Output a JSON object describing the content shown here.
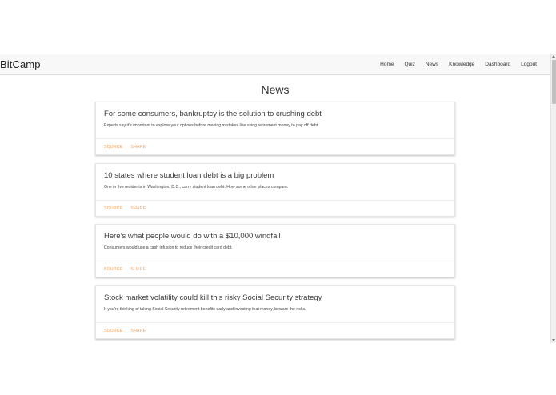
{
  "navbar": {
    "brand": "BitCamp",
    "links": [
      "Home",
      "Quiz",
      "News",
      "Knowledge",
      "Dashboard",
      "Logout"
    ]
  },
  "page": {
    "title": "News"
  },
  "articles": [
    {
      "title": "For some consumers, bankruptcy is the solution to crushing debt",
      "description": "Experts say it’s important to explore your options before making mistakes like using retirement money to pay off debt.",
      "source_label": "SOURCE",
      "share_label": "SHARE"
    },
    {
      "title": "10 states where student loan debt is a big problem",
      "description": "One in five residents in Washington, D.C., carry student loan debt. How some other places compare.",
      "source_label": "SOURCE",
      "share_label": "SHARE"
    },
    {
      "title": "Here’s what people would do with a $10,000 windfall",
      "description": "Consumers would use a cash infusion to reduce their credit card debt.",
      "source_label": "SOURCE",
      "share_label": "SHARE"
    },
    {
      "title": "Stock market volatility could kill this risky Social Security strategy",
      "description": "If you’re thinking of taking Social Security retirement benefits early and investing that money, beware the risks.",
      "source_label": "SOURCE",
      "share_label": "SHARE"
    }
  ],
  "colors": {
    "accent": "#f4a261",
    "navbar_bg": "#f8f8f8"
  }
}
